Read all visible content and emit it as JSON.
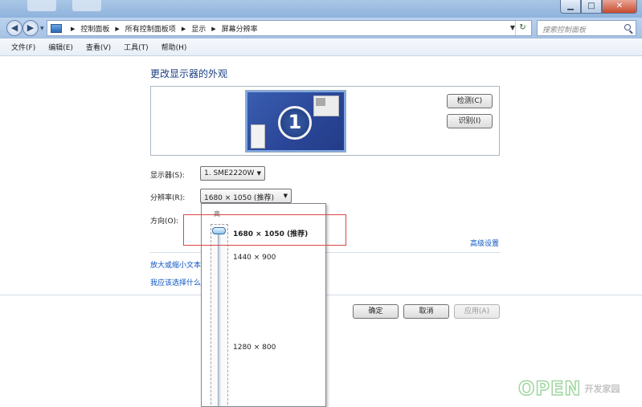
{
  "window": {
    "minimize": "▁",
    "maximize": "□",
    "close": "✕"
  },
  "address": {
    "crumbs": [
      "控制面板",
      "所有控制面板项",
      "显示",
      "屏幕分辨率"
    ],
    "search_placeholder": "搜索控制面板"
  },
  "menu": [
    "文件(F)",
    "编辑(E)",
    "查看(V)",
    "工具(T)",
    "帮助(H)"
  ],
  "main": {
    "heading": "更改显示器的外观",
    "monitor_number": "1",
    "detect_label": "检测(C)",
    "identify_label": "识别(I)",
    "display_label": "显示器(S):",
    "display_value": "1. SME2220W",
    "resolution_label": "分辨率(R):",
    "resolution_value": "1680 × 1050 (推荐)",
    "orientation_label": "方向(O):",
    "advanced_link": "高级设置",
    "link_text_size": "放大或缩小文本",
    "link_choose": "我应该选择什么",
    "ok_label": "确定",
    "cancel_label": "取消",
    "apply_label": "应用(A)"
  },
  "dropdown": {
    "high_label": "高",
    "options": [
      "1680 × 1050 (推荐)",
      "1440 × 900",
      "1280 × 800"
    ]
  },
  "watermark": {
    "big": "OPEN",
    "small": "开发家园"
  },
  "colors": {
    "link": "#0b55c4",
    "heading": "#1a3e84",
    "highlight": "#d94848"
  }
}
